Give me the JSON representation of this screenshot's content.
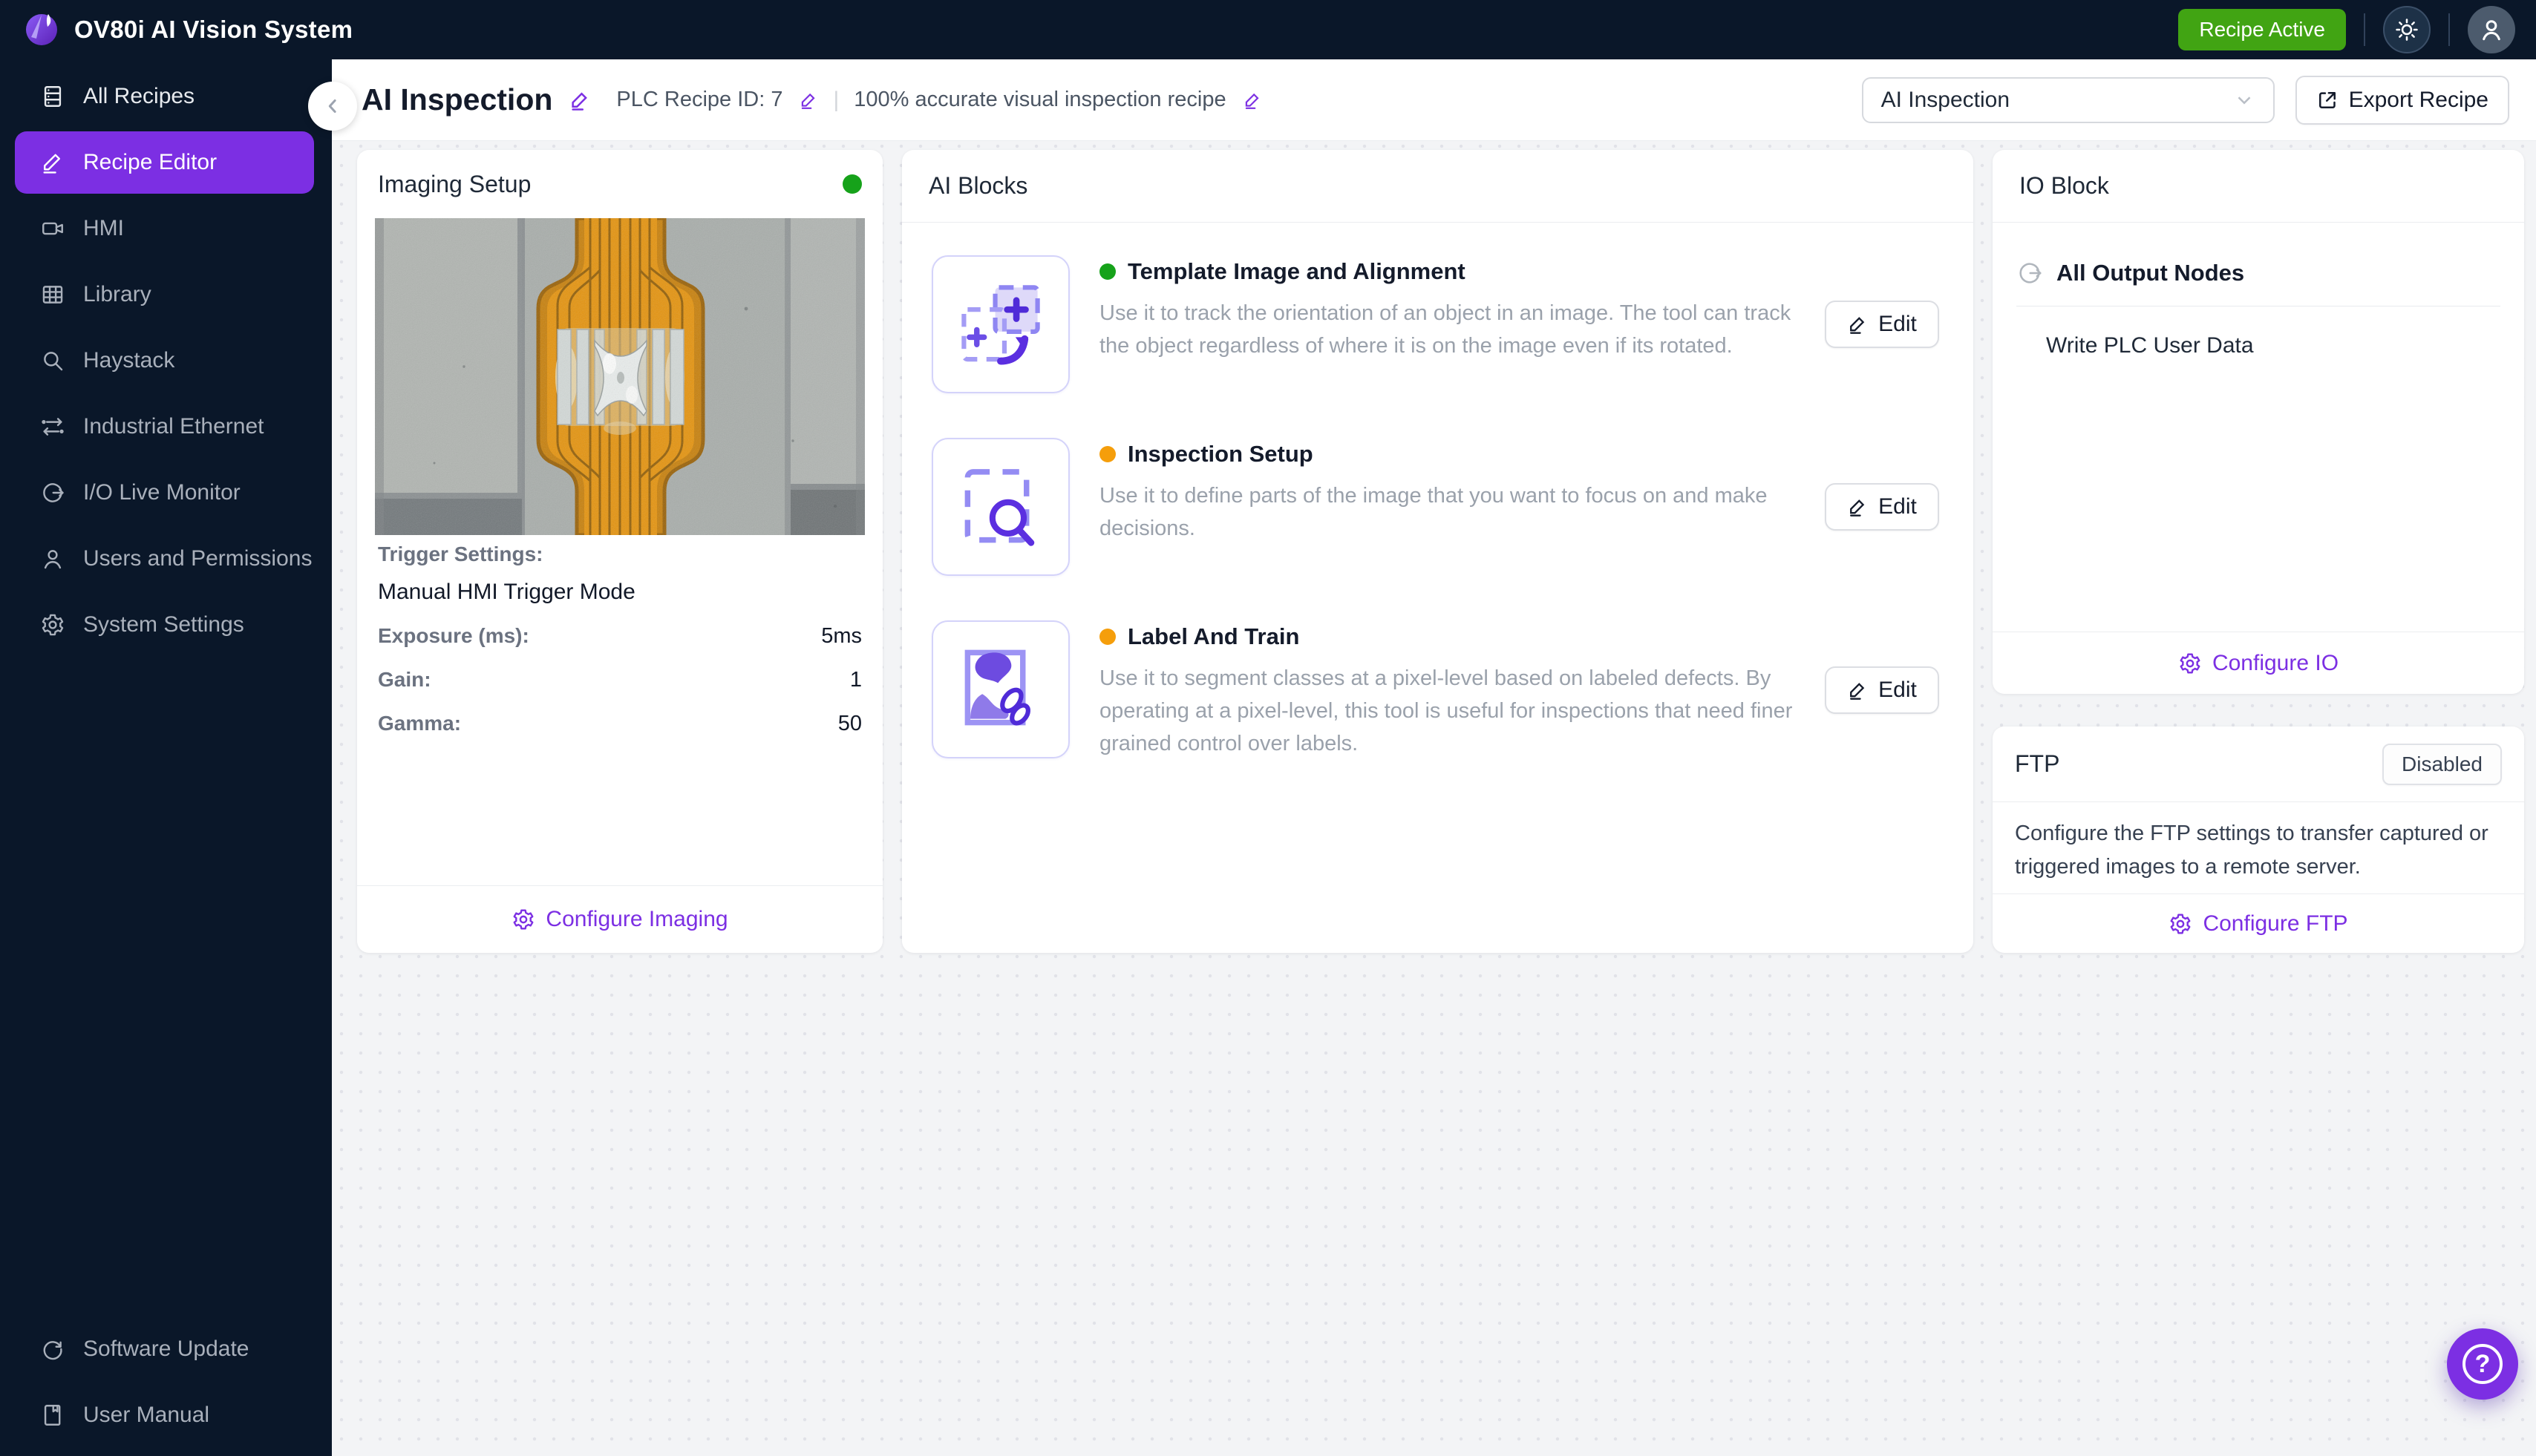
{
  "topbar": {
    "title": "OV80i AI Vision System",
    "status_badge": "Recipe Active"
  },
  "colors": {
    "badge_green": "#41a413",
    "green_status": "#16a21a",
    "orange_status": "#f59e0b",
    "accent_purple": "#7c2fe3"
  },
  "sidebar": {
    "items": [
      {
        "label": "All Recipes",
        "icon": "recipes-list-icon"
      },
      {
        "label": "Recipe Editor",
        "icon": "pencil-icon"
      },
      {
        "label": "HMI",
        "icon": "camera-icon"
      },
      {
        "label": "Library",
        "icon": "grid-icon"
      },
      {
        "label": "Haystack",
        "icon": "search-icon"
      },
      {
        "label": "Industrial Ethernet",
        "icon": "transfer-arrows-icon"
      },
      {
        "label": "I/O Live Monitor",
        "icon": "io-circle-arrow-icon"
      },
      {
        "label": "Users and Permissions",
        "icon": "user-icon"
      },
      {
        "label": "System Settings",
        "icon": "gear-icon"
      }
    ],
    "footer_items": [
      {
        "label": "Software Update",
        "icon": "refresh-icon"
      },
      {
        "label": "User Manual",
        "icon": "book-icon"
      }
    ]
  },
  "header": {
    "title": "AI Inspection",
    "plc_label": "PLC Recipe ID: 7",
    "meta_divider": "|",
    "subtitle": "100% accurate visual inspection recipe",
    "recipe_select_value": "AI Inspection",
    "export_label": "Export Recipe"
  },
  "imaging": {
    "title": "Imaging Setup",
    "status_color": "#16a21a",
    "trigger_label": "Trigger Settings:",
    "trigger_value": "Manual HMI Trigger Mode",
    "rows": [
      {
        "label": "Exposure (ms):",
        "value": "5ms"
      },
      {
        "label": "Gain:",
        "value": "1"
      },
      {
        "label": "Gamma:",
        "value": "50"
      }
    ],
    "configure_label": "Configure Imaging"
  },
  "ai_blocks": {
    "title": "AI Blocks",
    "edit_label": "Edit",
    "blocks": [
      {
        "name": "Template Image and Alignment",
        "status_color": "#16a21a",
        "description": "Use it to track the orientation of an object in an image. The tool can track the object regardless of where it is on the image even if its rotated."
      },
      {
        "name": "Inspection Setup",
        "status_color": "#f59e0b",
        "description": "Use it to define parts of the image that you want to focus on and make decisions."
      },
      {
        "name": "Label And Train",
        "status_color": "#f59e0b",
        "description": "Use it to segment classes at a pixel-level based on labeled defects. By operating at a pixel-level, this tool is useful for inspections that need finer grained control over labels."
      }
    ]
  },
  "io_block": {
    "title": "IO Block",
    "group_title": "All Output Nodes",
    "node": "Write PLC User Data",
    "configure_label": "Configure IO"
  },
  "ftp": {
    "title": "FTP",
    "status": "Disabled",
    "description": "Configure the FTP settings to transfer captured or triggered images to a remote server.",
    "configure_label": "Configure FTP"
  },
  "help": {
    "label": "?"
  }
}
